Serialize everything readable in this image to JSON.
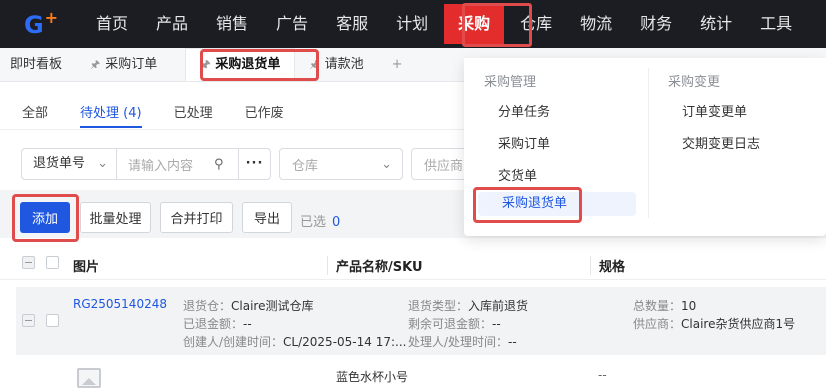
{
  "nav": {
    "items": [
      "首页",
      "产品",
      "销售",
      "广告",
      "客服",
      "计划",
      "采购",
      "仓库",
      "物流",
      "财务",
      "统计",
      "工具"
    ],
    "active_index": 6
  },
  "tabs": {
    "items": [
      "即时看板",
      "采购订单",
      "采购退货单",
      "请款池"
    ],
    "add": "+"
  },
  "status_tabs": [
    "全部",
    "待处理 (4)",
    "已处理",
    "已作废"
  ],
  "filters": {
    "type_select": "退货单号",
    "search_placeholder": "请输入内容",
    "more": "···",
    "warehouse_placeholder": "仓库",
    "supplier_placeholder": "供应商"
  },
  "toolbar": {
    "add": "添加",
    "batch": "批量处理",
    "merge_print": "合并打印",
    "export": "导出",
    "selected_label": "已选",
    "selected_count": "0"
  },
  "table": {
    "headers": [
      "图片",
      "产品名称/SKU",
      "规格"
    ]
  },
  "row": {
    "id": "RG2505140248",
    "warehouse_label": "退货仓：",
    "warehouse": "Claire测试仓库",
    "refunded_label": "已退金额：",
    "refunded": "--",
    "creator_label": "创建人/创建时间：",
    "creator": "CL/2025-05-14 17:...",
    "type_label": "退货类型：",
    "type": "入库前退货",
    "remaining_label": "剩余可退金额：",
    "remaining": "--",
    "handler_label": "处理人/处理时间：",
    "handler": "--",
    "qty_label": "总数量：",
    "qty": "10",
    "supplier_label": "供应商：",
    "supplier": "Claire杂货供应商1号"
  },
  "subrow": {
    "product_name": "蓝色水杯小号",
    "spec": "--"
  },
  "dropdown": {
    "col1_title": "采购管理",
    "col1_items": [
      "分单任务",
      "采购订单",
      "交货单",
      "采购退货单"
    ],
    "col2_title": "采购变更",
    "col2_items": [
      "订单变更单",
      "交期变更日志"
    ]
  },
  "colors": {
    "nav_bg": "#1b1d22",
    "nav_active": "#e32d2d",
    "primary": "#1f57e0",
    "highlight": "#e04b4b"
  }
}
